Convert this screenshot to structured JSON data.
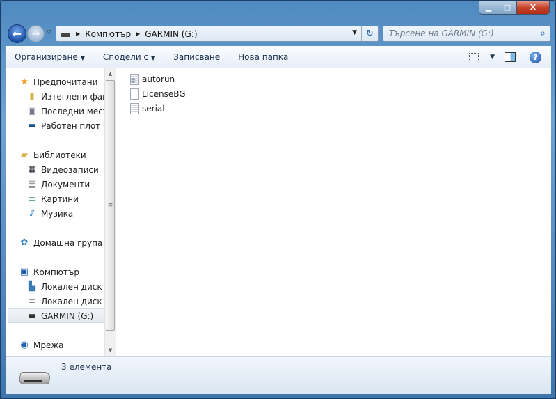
{
  "window": {
    "minimize": "▁",
    "maximize": "□",
    "close": "X"
  },
  "nav": {
    "back": "←",
    "forward": "→",
    "history": "▽"
  },
  "address": {
    "crumbs": [
      "Компютър",
      "GARMIN (G:)"
    ],
    "dropdown": "▼",
    "refresh": "↻"
  },
  "search": {
    "placeholder": "Търсене на GARMIN (G:)",
    "icon": "⌕"
  },
  "toolbar": {
    "organize": "Организиране",
    "share": "Сподели с",
    "burn": "Записване",
    "new_folder": "Нова папка",
    "help": "?",
    "dropdown": "▼"
  },
  "sidebar": {
    "favorites": {
      "label": "Предпочитани",
      "items": [
        "Изтеглени файлове",
        "Последни места",
        "Работен плот"
      ]
    },
    "libraries": {
      "label": "Библиотеки",
      "items": [
        "Видеозаписи",
        "Документи",
        "Картини",
        "Музика"
      ]
    },
    "homegroup": "Домашна група",
    "computer": {
      "label": "Компютър",
      "items": [
        "Локален диск (C:)",
        "Локален диск (D:)",
        "GARMIN (G:)"
      ]
    },
    "network": "Мрежа"
  },
  "files": [
    {
      "name": "autorun",
      "icon": "settings-file"
    },
    {
      "name": "LicenseBG",
      "icon": "text-file"
    },
    {
      "name": "serial",
      "icon": "text-file"
    }
  ],
  "status": {
    "count": "3 елемента"
  }
}
